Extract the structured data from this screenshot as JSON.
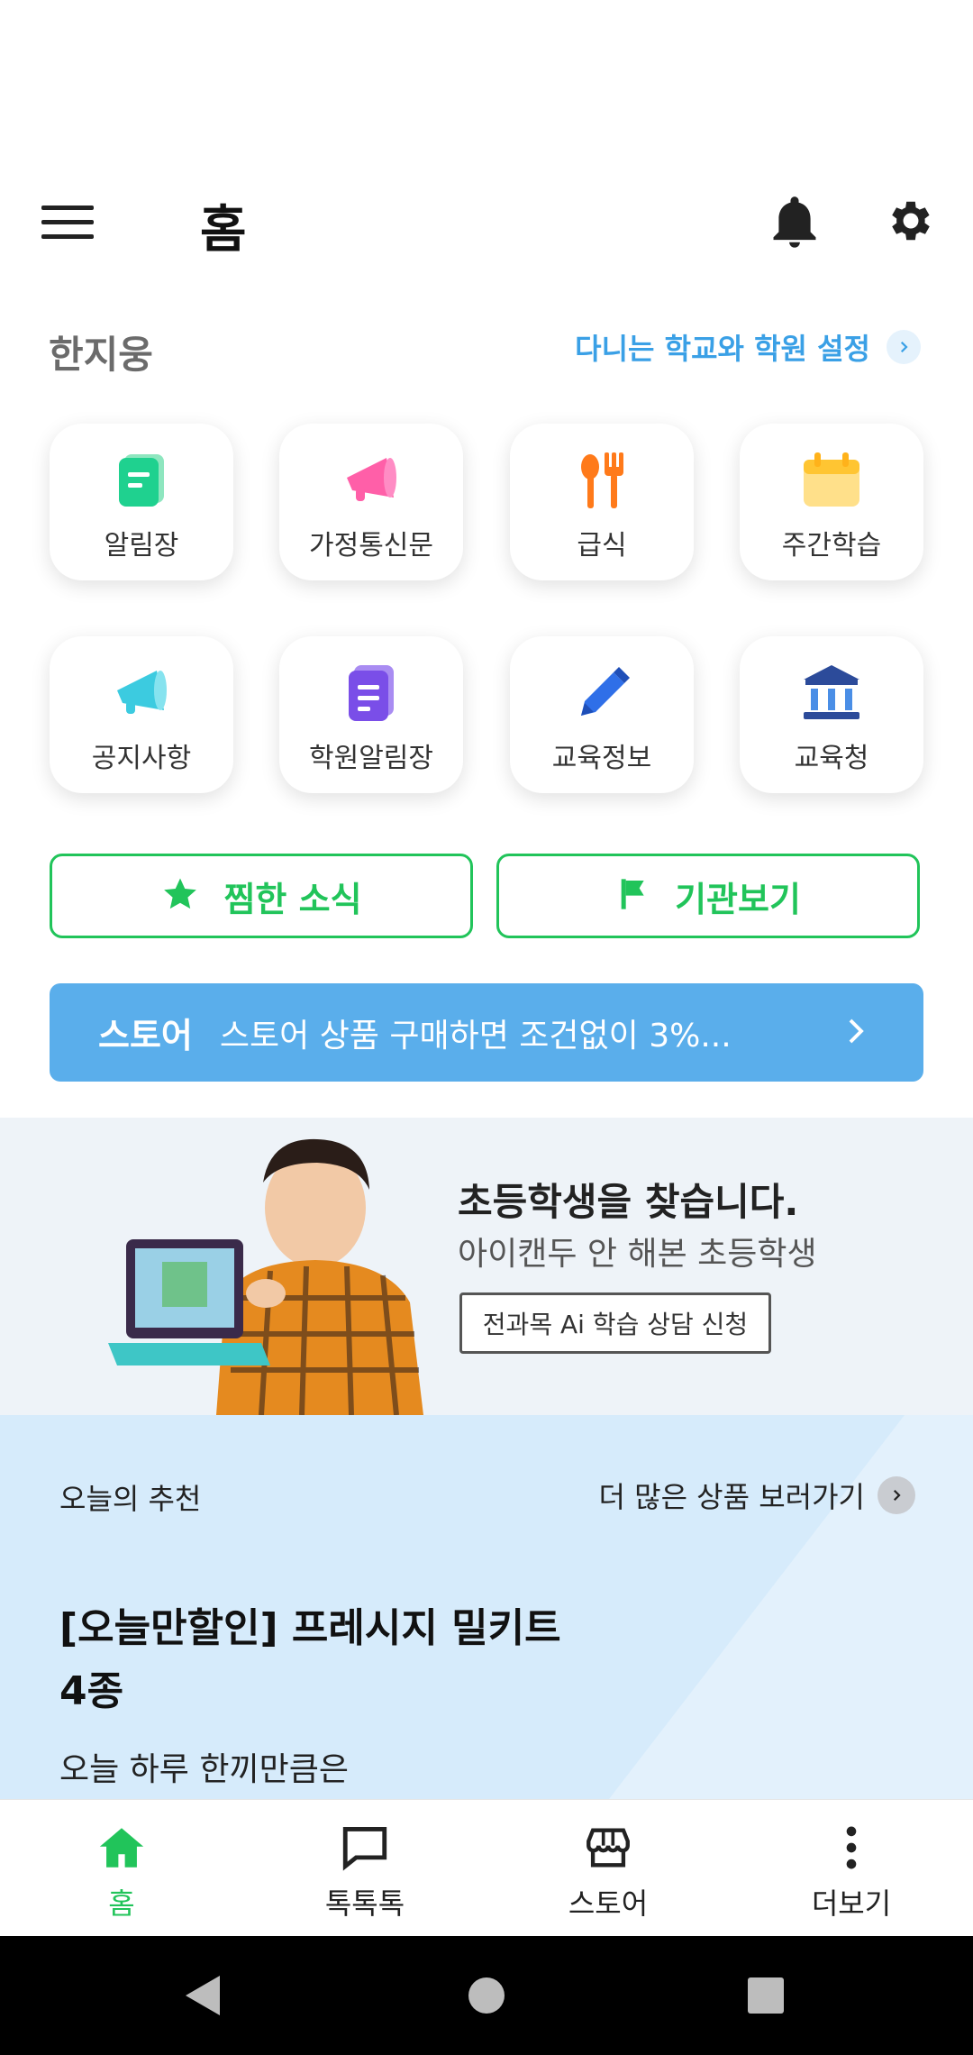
{
  "header": {
    "title": "홈"
  },
  "greeting": {
    "name": "한지웅",
    "school_link": "다니는 학교와 학원 설정"
  },
  "grid": [
    {
      "label": "알림장"
    },
    {
      "label": "가정통신문"
    },
    {
      "label": "급식"
    },
    {
      "label": "주간학습"
    },
    {
      "label": "공지사항"
    },
    {
      "label": "학원알림장"
    },
    {
      "label": "교육정보"
    },
    {
      "label": "교육청"
    }
  ],
  "actions": {
    "bookmarks": "찜한 소식",
    "institutions": "기관보기"
  },
  "store_banner": {
    "tag": "스토어",
    "message": "스토어 상품 구매하면 조건없이 3%..."
  },
  "ad": {
    "title": "초등학생을 찾습니다.",
    "subtitle": "아이캔두 안 해본 초등학생",
    "button": "전과목 Ai 학습 상담 신청"
  },
  "recommendation": {
    "label": "오늘의 추천",
    "more": "더 많은 상품 보러가기",
    "title": "[오늘만할인] 프레시지 밀키트 4종",
    "desc": "오늘 하루 한끼만큼은"
  },
  "bottom_nav": [
    {
      "label": "홈"
    },
    {
      "label": "톡톡톡"
    },
    {
      "label": "스토어"
    },
    {
      "label": "더보기"
    }
  ],
  "colors": {
    "accent_green": "#21c45a",
    "link_blue": "#3aa0e6",
    "store_blue": "#5aaeeb"
  }
}
